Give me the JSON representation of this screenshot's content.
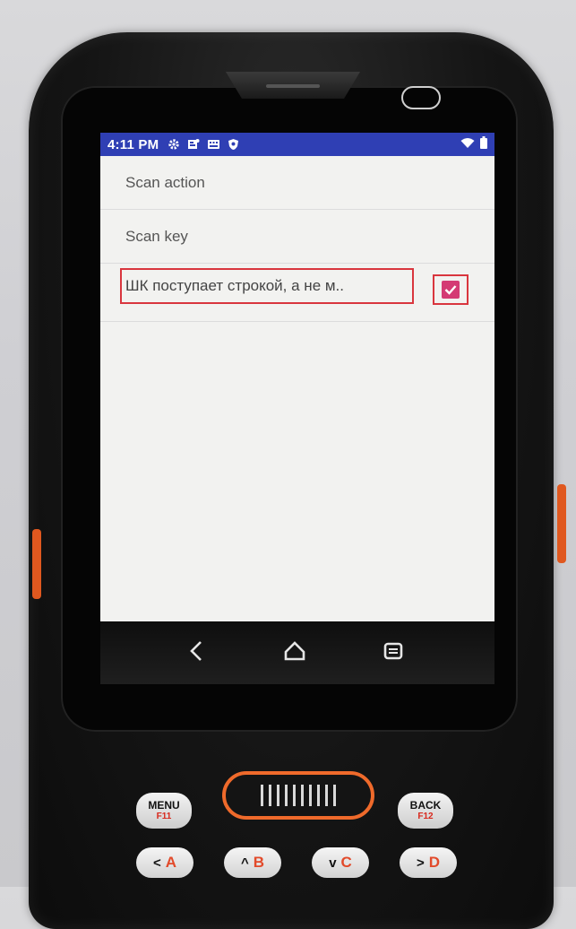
{
  "status_bar": {
    "time": "4:11 PM",
    "icons": [
      "settings-gear-icon",
      "notification-icon",
      "keyboard-icon",
      "shield-icon"
    ],
    "right_icons": [
      "wifi-icon",
      "battery-icon"
    ]
  },
  "preferences": [
    {
      "title": "Scan action"
    },
    {
      "title": "Scan key"
    }
  ],
  "checkbox_pref": {
    "title": "ШК поступает строкой, а не м..",
    "checked": true
  },
  "nav": {
    "buttons": [
      "back-icon",
      "home-icon",
      "recents-icon"
    ]
  },
  "hardware_keys": {
    "menu": {
      "label": "MENU",
      "sub": "F11"
    },
    "back": {
      "label": "BACK",
      "sub": "F12"
    },
    "row": [
      {
        "arrow": "<",
        "letter": "A"
      },
      {
        "arrow": "^",
        "letter": "B"
      },
      {
        "arrow": "v",
        "letter": "C"
      },
      {
        "arrow": ">",
        "letter": "D"
      }
    ]
  },
  "colors": {
    "status_bar": "#2f3fb4",
    "accent_checkbox": "#d43a74",
    "highlight_frame": "#d9363e",
    "scan_ring": "#ef6a2b"
  }
}
